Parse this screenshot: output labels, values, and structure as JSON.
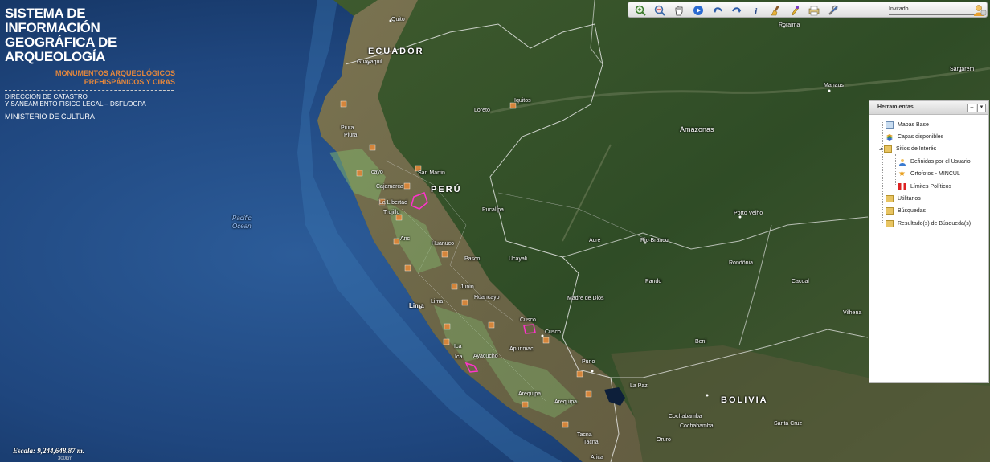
{
  "header": {
    "title_line1": "SISTEMA DE INFORMACIÓN",
    "title_line2": "GEOGRÁFICA DE ARQUEOLOGÍA",
    "subtitle_line1": "MONUMENTOS ARQUEOLÓGICOS",
    "subtitle_line2": "PREHISPÁNICOS Y CIRAS",
    "org_line1": "DIRECCION DE CATASTRO",
    "org_line2": "Y SANEAMIENTO FISICO LEGAL – DSFL/DGPA",
    "ministry": "MINISTERIO DE CULTURA"
  },
  "toolbar": {
    "tools": [
      "zoom-in-icon",
      "zoom-out-icon",
      "pan-hand-icon",
      "full-extent-icon",
      "undo-arrow-icon",
      "redo-arrow-icon",
      "identify-info-icon",
      "clear-broom-icon",
      "draw-pen-icon",
      "print-icon",
      "tools-wrench-icon"
    ],
    "user_label": "Invitado"
  },
  "panel": {
    "title": "Herramientas",
    "items": [
      {
        "label": "Mapas Base"
      },
      {
        "label": "Capas disponibles"
      },
      {
        "label": "Sitios de Interés"
      },
      {
        "label": "Definidas por el Usuario"
      },
      {
        "label": "Ortofotos - MINCUL"
      },
      {
        "label": "Límites Políticos"
      },
      {
        "label": "Utilitarios"
      },
      {
        "label": "Búsquedas"
      },
      {
        "label": "Resultado(s) de Búsqueda(s)"
      }
    ]
  },
  "map_labels": {
    "countries": {
      "ecuador": "ECUADOR",
      "peru": "PERÚ",
      "bolivia": "BOLIVIA"
    },
    "ocean": {
      "line1": "Pacific",
      "line2": "Ocean"
    },
    "places": {
      "quito": "Quito",
      "guayaquil": "Guayaquil",
      "roraima": "Roraima",
      "manaus": "Manaus",
      "santarem": "Santarem",
      "loreto": "Loreto",
      "iquitos": "Iquitos",
      "amazonas": "Amazonas",
      "piura": "Piura",
      "piura2": "Piura",
      "cajamarca": "Cajamarca",
      "la_libertad": "La Libertad",
      "trujillo": "Trujillo",
      "san_martin": "San Martin",
      "ucayali": "Ucayali",
      "pucallpa": "Pucallpa",
      "pasco": "Pasco",
      "huanuco": "Huanuco",
      "junin": "Junin",
      "huancayo": "Huancayo",
      "lima": "Lima",
      "lima2": "Lima",
      "acre": "Acre",
      "rio_branco": "Rio Branco",
      "porto_velho": "Porto Velho",
      "rondonia": "Rondônia",
      "cacoal": "Cacoal",
      "vilhena": "Vilhena",
      "pando": "Pando",
      "madre_de_dios": "Madre de Dios",
      "cusco": "Cusco",
      "cusco2": "Cusco",
      "apurimac": "Apurimac",
      "ayacucho": "Ayacucho",
      "ica": "Ica",
      "ica2": "Ica",
      "puno": "Puno",
      "beni": "Beni",
      "la_paz": "La Paz",
      "arequipa": "Arequipa",
      "arequipa2": "Arequipa",
      "cochabamba": "Cochabamba",
      "cochabamba2": "Cochabamba",
      "oruro": "Oruro",
      "santa_cruz": "Santa Cruz",
      "tacna": "Tacna",
      "tacna2": "Tacna",
      "arica": "Arica",
      "anc": "Anc",
      "cayo": "cayo"
    }
  },
  "scale": {
    "label": "Escala: 9,244,648.87 m.",
    "bar": "300km"
  },
  "colors": {
    "accent_orange": "#e4873c",
    "ocean": "#1d3b6b",
    "highlight_magenta": "#ff33cc",
    "marker": "#d4853b"
  }
}
